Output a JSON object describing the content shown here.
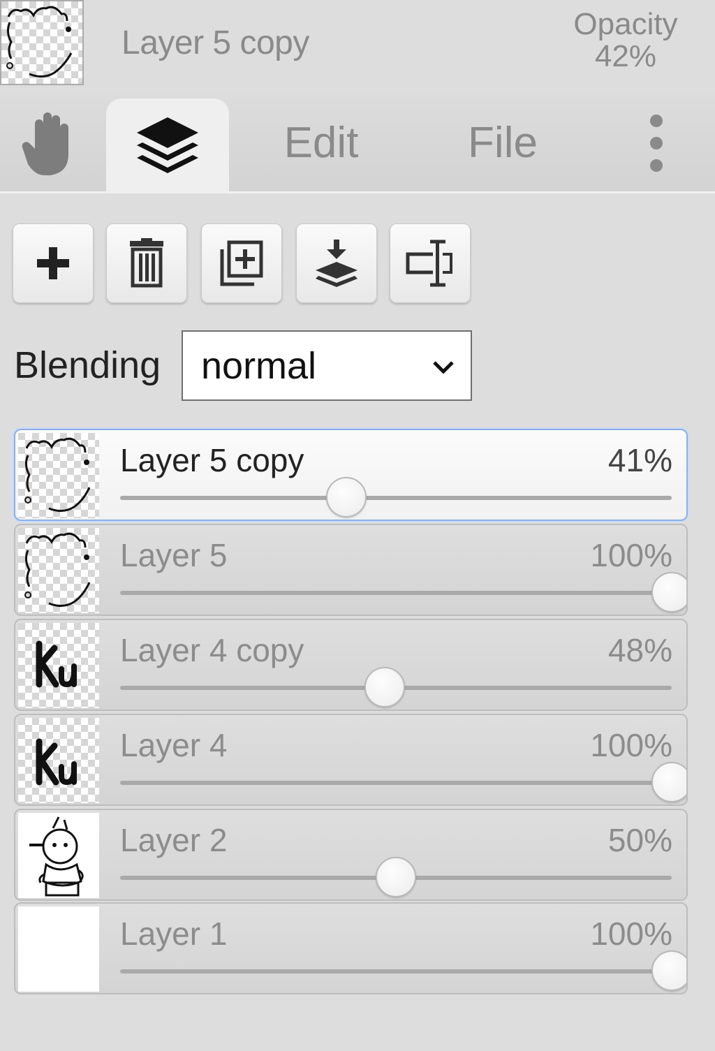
{
  "header": {
    "layer_title": "Layer 5 copy",
    "opacity_label": "Opacity",
    "opacity_value": "42%"
  },
  "tabs": {
    "hand_icon": "hand-icon",
    "layers_icon": "layers-icon",
    "edit_label": "Edit",
    "file_label": "File",
    "more_icon": "more-vertical-icon"
  },
  "toolbar": {
    "buttons": [
      {
        "icon": "plus-icon"
      },
      {
        "icon": "trash-icon"
      },
      {
        "icon": "duplicate-icon"
      },
      {
        "icon": "merge-down-icon"
      },
      {
        "icon": "rename-icon"
      }
    ]
  },
  "blending": {
    "label": "Blending",
    "value": "normal"
  },
  "layers": [
    {
      "name": "Layer 5 copy",
      "opacity_text": "41%",
      "opacity": 0.41,
      "thumb": "border-doodle",
      "active": true
    },
    {
      "name": "Layer 5",
      "opacity_text": "100%",
      "opacity": 1.0,
      "thumb": "border-doodle",
      "active": false
    },
    {
      "name": "Layer 4 copy",
      "opacity_text": "48%",
      "opacity": 0.48,
      "thumb": "ku-text",
      "active": false
    },
    {
      "name": "Layer 4",
      "opacity_text": "100%",
      "opacity": 1.0,
      "thumb": "ku-text",
      "active": false
    },
    {
      "name": "Layer 2",
      "opacity_text": "50%",
      "opacity": 0.5,
      "thumb": "character",
      "active": false
    },
    {
      "name": "Layer 1",
      "opacity_text": "100%",
      "opacity": 1.0,
      "thumb": "white",
      "active": false
    }
  ]
}
